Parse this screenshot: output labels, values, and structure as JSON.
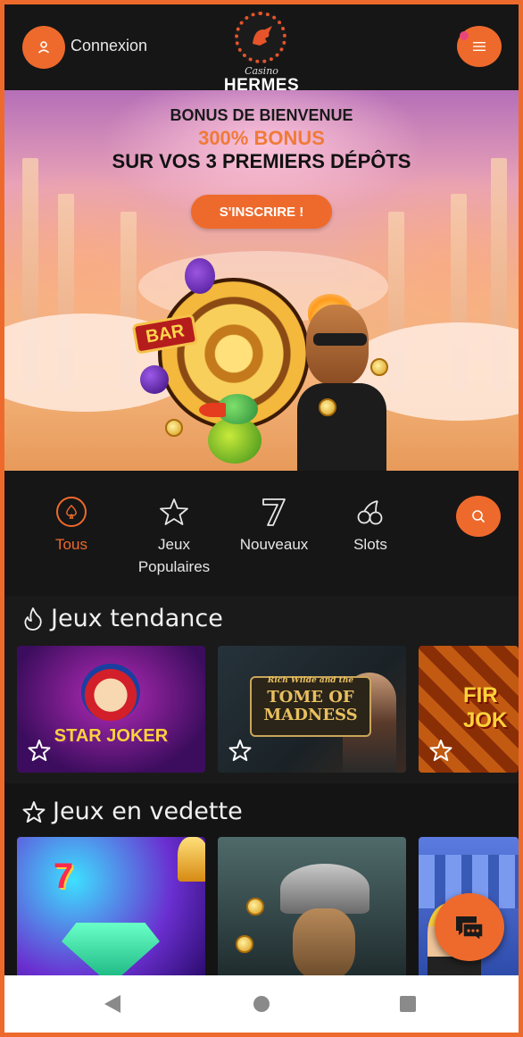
{
  "header": {
    "login_label": "Connexion",
    "logo_casino": "Casino",
    "logo_brand": "HERMES"
  },
  "hero": {
    "title": "BONUS DE BIENVENUE",
    "bonus": "300% BONUS",
    "subtitle": "SUR VOS 3 PREMIERS DÉPÔTS",
    "cta_label": "S'INSCRIRE !",
    "bar_sign": "BAR"
  },
  "categories": [
    {
      "label": "Tous",
      "icon": "spade-icon",
      "active": true
    },
    {
      "label": "Jeux\nPopulaires",
      "icon": "star-icon",
      "active": false
    },
    {
      "label": "Nouveaux",
      "icon": "seven-icon",
      "active": false
    },
    {
      "label": "Slots",
      "icon": "cherries-icon",
      "active": false
    }
  ],
  "sections": {
    "trending": {
      "title": "Jeux tendance",
      "games": [
        {
          "name": "STAR JOKER"
        },
        {
          "name_top": "Rich Wilde and the",
          "name": "TOME OF MADNESS"
        },
        {
          "name": "FIRE JOKER",
          "visible_text": "FIR JOK"
        }
      ]
    },
    "featured": {
      "title": "Jeux en vedette",
      "games": [
        {
          "name": "7"
        },
        {
          "name": ""
        },
        {
          "name": ""
        }
      ]
    }
  },
  "colors": {
    "accent": "#ee6a2c",
    "background": "#161616",
    "navbar": "#ffffff"
  }
}
